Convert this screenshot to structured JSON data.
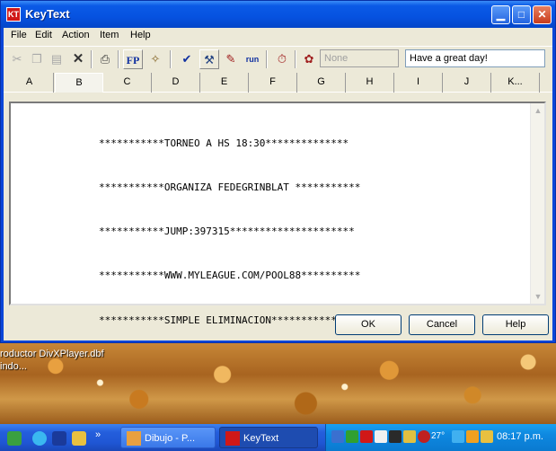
{
  "window": {
    "title": "KeyText",
    "app_icon": "KT"
  },
  "menu": [
    "File",
    "Edit",
    "Action",
    "Item",
    "Help"
  ],
  "toolbar": {
    "fp_label": "FP",
    "run_label": "run",
    "none_field": "None",
    "message_field": "Have a great day!"
  },
  "tabs": [
    "A",
    "B",
    "C",
    "D",
    "E",
    "F",
    "G",
    "H",
    "I",
    "J",
    "K..."
  ],
  "active_tab": "B",
  "editor": {
    "lines": [
      "***********TORNEO A HS 18:30**************",
      "***********ORGANIZA FEDEGRINBLAT ***********",
      "***********JUMP:397315*********************",
      "***********WWW.MYLEAGUE.COM/POOL88**********",
      "***********SIMPLE ELIMINACION**************"
    ]
  },
  "buttons": {
    "ok": "OK",
    "cancel": "Cancel",
    "help": "Help"
  },
  "desktop": {
    "label1": "roductor   DivXPlayer.dbf",
    "label2": "indo..."
  },
  "taskbar": {
    "tasks": [
      {
        "label": "Dibujo - P...",
        "active": false
      },
      {
        "label": "KeyText",
        "active": true
      }
    ],
    "tray_temp": "27°",
    "clock": "08:17 p.m."
  },
  "colors": {
    "title_bar": "#0652e0",
    "client_bg": "#ece9d8",
    "app_icon": "#d01818",
    "close_button": "#c83c1c"
  }
}
